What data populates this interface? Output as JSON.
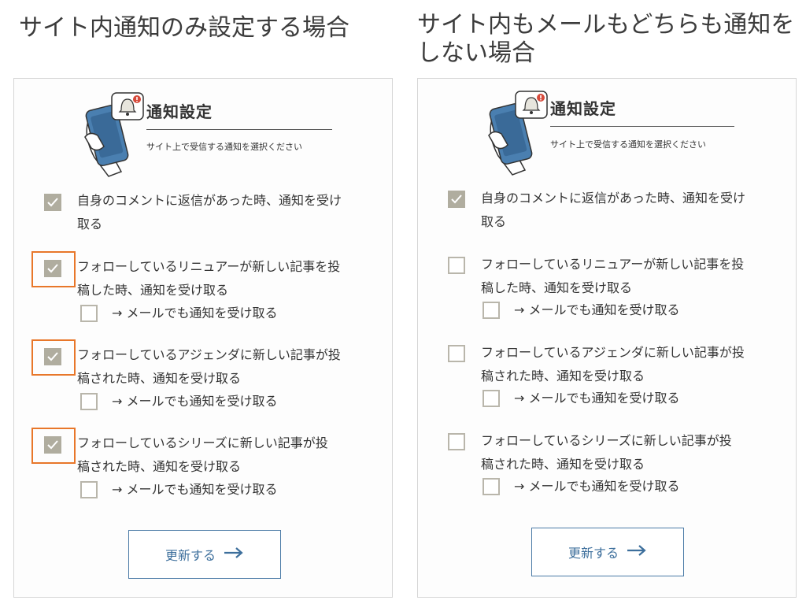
{
  "headings": {
    "left": "サイト内通知のみ設定する場合",
    "right": "サイト内もメールもどちらも通知をしない場合"
  },
  "panel": {
    "title": "通知設定",
    "subtitle": "サイト上で受信する通知を選択ください",
    "update_label": "更新する"
  },
  "options": {
    "comment_line1": "自身のコメントに返信があった時、通知を受け",
    "comment_line2": "取る",
    "renewer_line1": "フォローしているリニュアーが新しい記事を投",
    "renewer_line2": "稿した時、通知を受け取る",
    "agenda_line1": "フォローしているアジェンダに新しい記事が投",
    "agenda_line2": "稿された時、通知を受け取る",
    "series_line1": "フォローしているシリーズに新しい記事が投",
    "series_line2": "稿された時、通知を受け取る",
    "mail_label": "→ メールでも通知を受け取る"
  },
  "left_state": {
    "comment": true,
    "renewer": true,
    "renewer_mail": false,
    "agenda": true,
    "agenda_mail": false,
    "series": true,
    "series_mail": false
  },
  "right_state": {
    "comment": true,
    "renewer": false,
    "renewer_mail": false,
    "agenda": false,
    "agenda_mail": false,
    "series": false,
    "series_mail": false
  },
  "colors": {
    "highlight": "#e8772a",
    "checked": "#b0ad9f",
    "button_accent": "#3d6f9c"
  },
  "icons": {
    "illustration": "phone-bell-notification-icon",
    "arrow": "arrow-right-icon",
    "check": "checkmark-icon"
  }
}
